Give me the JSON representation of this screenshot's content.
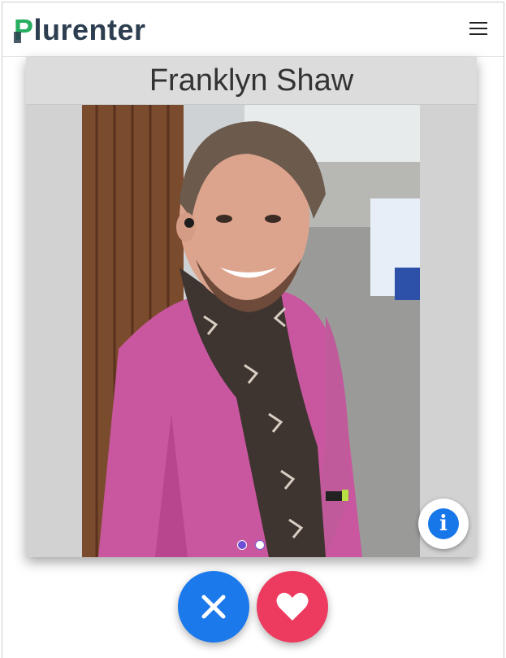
{
  "app": {
    "brand_first": "P",
    "brand_rest": "lurenter"
  },
  "profile": {
    "name": "Franklyn Shaw",
    "photo_count": 2,
    "active_photo": 1
  },
  "actions": {
    "info_symbol": "i",
    "reject_icon": "close-icon",
    "like_icon": "heart-icon"
  },
  "colors": {
    "brand_green": "#27ae60",
    "brand_dark": "#2c3e50",
    "info_blue": "#1877e8",
    "reject_blue": "#1b79ec",
    "like_pink": "#ec3b5f",
    "dot_active": "#6c4fd6"
  }
}
